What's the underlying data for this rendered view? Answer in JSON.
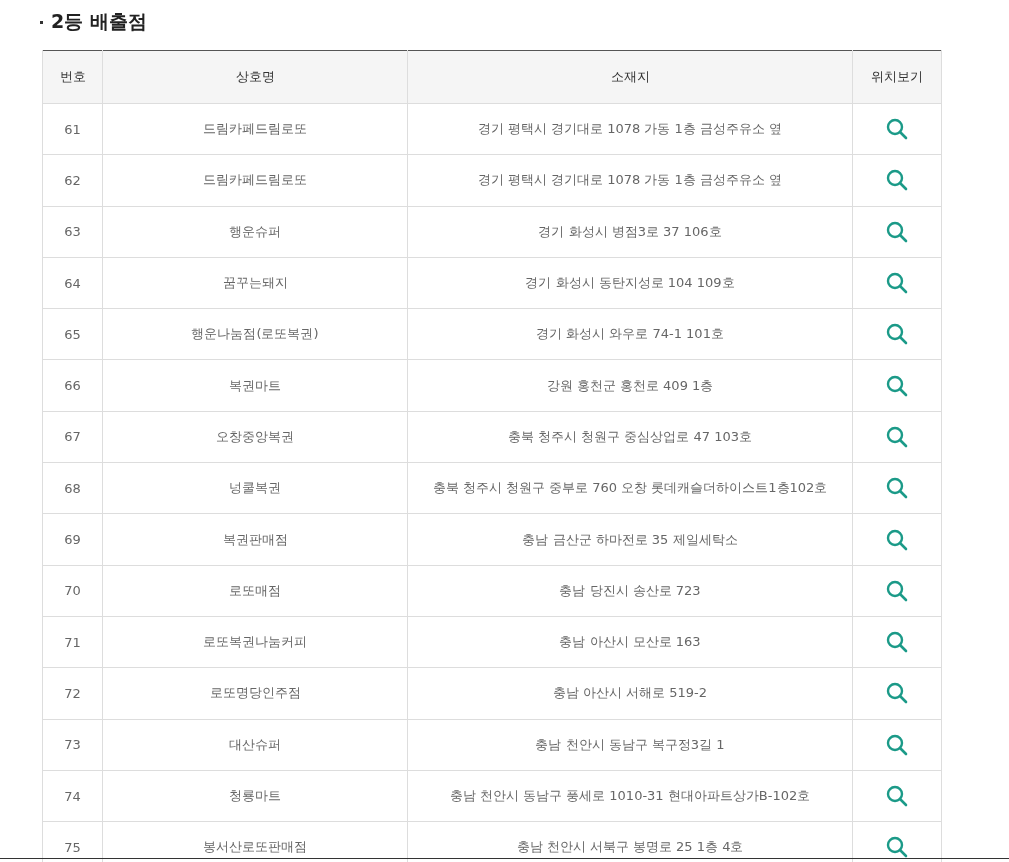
{
  "section_title": "2등 배출점",
  "table": {
    "columns": [
      "번호",
      "상호명",
      "소재지",
      "위치보기"
    ],
    "rows": [
      {
        "no": "61",
        "name": "드림카페드림로또",
        "address": "경기 평택시 경기대로 1078 가동 1층 금성주유소 옆"
      },
      {
        "no": "62",
        "name": "드림카페드림로또",
        "address": "경기 평택시 경기대로 1078 가동 1층 금성주유소 옆"
      },
      {
        "no": "63",
        "name": "행운슈퍼",
        "address": "경기 화성시 병점3로 37 106호"
      },
      {
        "no": "64",
        "name": "꿈꾸는돼지",
        "address": "경기 화성시 동탄지성로 104 109호"
      },
      {
        "no": "65",
        "name": "행운나눔점(로또복권)",
        "address": "경기 화성시 와우로 74-1 101호"
      },
      {
        "no": "66",
        "name": "복권마트",
        "address": "강원 홍천군 홍천로 409 1층"
      },
      {
        "no": "67",
        "name": "오창중앙복권",
        "address": "충북 청주시 청원구 중심상업로 47 103호"
      },
      {
        "no": "68",
        "name": "넝쿨복권",
        "address": "충북 청주시 청원구 중부로 760 오창 롯데캐슬더하이스트1층102호"
      },
      {
        "no": "69",
        "name": "복권판매점",
        "address": "충남 금산군 하마전로 35 제일세탁소"
      },
      {
        "no": "70",
        "name": "로또매점",
        "address": "충남 당진시 송산로 723"
      },
      {
        "no": "71",
        "name": "로또복권나눔커피",
        "address": "충남 아산시 모산로 163"
      },
      {
        "no": "72",
        "name": "로또명당인주점",
        "address": "충남 아산시 서해로 519-2"
      },
      {
        "no": "73",
        "name": "대산슈퍼",
        "address": "충남 천안시 동남구 복구정3길 1"
      },
      {
        "no": "74",
        "name": "청룡마트",
        "address": "충남 천안시 동남구 풍세로 1010-31 현대아파트상가B-102호"
      },
      {
        "no": "75",
        "name": "봉서산로또판매점",
        "address": "충남 천안시 서북구 봉명로 25 1층 4호"
      }
    ]
  }
}
